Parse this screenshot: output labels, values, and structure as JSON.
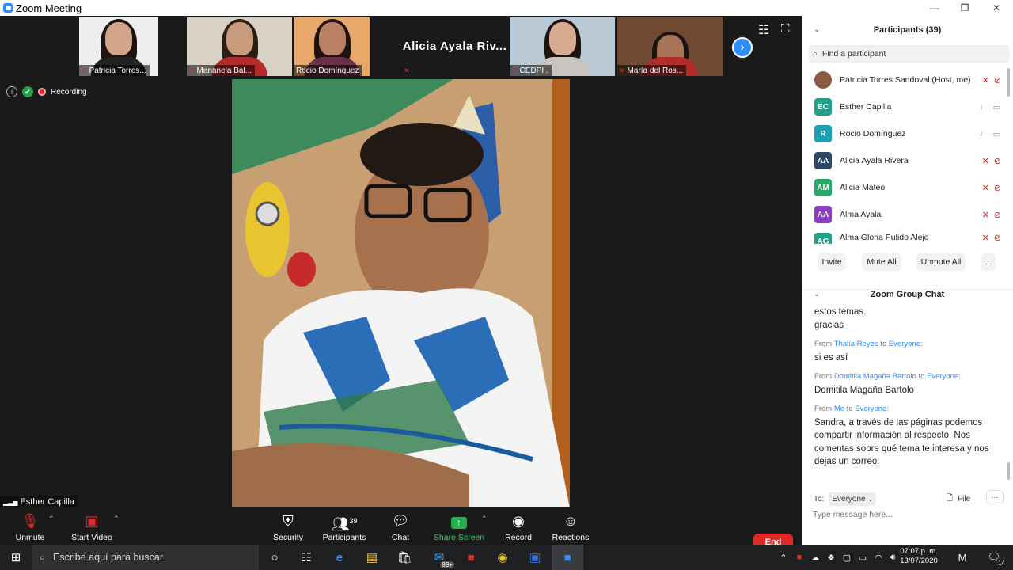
{
  "window": {
    "title": "Zoom Meeting",
    "min": "—",
    "max": "❐",
    "close": "✕"
  },
  "strip": {
    "thumbs": [
      {
        "name": "Patricia Torres..."
      },
      {
        "name": "Marianela Bal..."
      },
      {
        "name": "Rocio Domínguez"
      },
      {
        "name": "Alicia  Ayala  Riv..."
      },
      {
        "name": "CEDPI ."
      },
      {
        "name": "María del Ros..."
      }
    ],
    "next": "›",
    "grid_icon": "☷",
    "full_icon": "⛶"
  },
  "status": {
    "info": "i",
    "shield": "✔",
    "recording": "Recording"
  },
  "speaker": {
    "name": "Esther Capilla",
    "signal": "▂▃▅"
  },
  "toolbar": {
    "unmute": "Unmute",
    "start_video": "Start Video",
    "security": "Security",
    "participants": "Participants",
    "participants_count": "39",
    "chat": "Chat",
    "share": "Share Screen",
    "record": "Record",
    "reactions": "Reactions",
    "end": "End"
  },
  "participants_panel": {
    "title": "Participants (39)",
    "search_placeholder": "Find a participant",
    "items": [
      {
        "initials": "",
        "name": "Patricia Torres Sandoval (Host, me)",
        "color": "#8a5a44",
        "audio": "muted",
        "video": "off"
      },
      {
        "initials": "EC",
        "name": "Esther Capilla",
        "color": "#23a08a",
        "audio": "on",
        "video": "on"
      },
      {
        "initials": "R",
        "name": "Rocio Domínguez",
        "color": "#1f9eb8",
        "audio": "on",
        "video": "on"
      },
      {
        "initials": "AA",
        "name": "Alicia Ayala Rivera",
        "color": "#2d4766",
        "audio": "muted",
        "video": "off"
      },
      {
        "initials": "AM",
        "name": "Alicia Mateo",
        "color": "#29a86a",
        "audio": "muted",
        "video": "off"
      },
      {
        "initials": "AA",
        "name": "Alma Ayala",
        "color": "#8a3fbf",
        "audio": "muted",
        "video": "off"
      },
      {
        "initials": "AG",
        "name": "Alma Gloria Pulido Alejo",
        "color": "#23a08a",
        "audio": "muted",
        "video": "off"
      }
    ],
    "invite": "Invite",
    "mute_all": "Mute All",
    "unmute_all": "Unmute All",
    "more": "..."
  },
  "chat": {
    "title": "Zoom Group Chat",
    "messages": [
      {
        "from": "",
        "to": "",
        "text": "estos temas.\ngracias"
      },
      {
        "from": "Thalía Reyes",
        "to": "Everyone",
        "text": "si es así"
      },
      {
        "from": "Domitila Magaña Bartolo",
        "to": "Everyone",
        "text": "Domitila Magaña Bartolo"
      },
      {
        "from": "Me",
        "to": "Everyone",
        "text": "Sandra, a través de las páginas podemos compartir información al respecto. Nos comentas sobre qué tema te interesa y nos dejas un correo."
      }
    ],
    "from_word": "From",
    "to_word": "to",
    "to_label": "To:",
    "to_value": "Everyone",
    "file": "File",
    "more": "···",
    "placeholder": "Type message here..."
  },
  "taskbar": {
    "search_placeholder": "Escribe aquí para buscar",
    "time": "07:07 p. m.",
    "date": "13/07/2020",
    "mail_badge": "99+",
    "notif_count": "14"
  }
}
